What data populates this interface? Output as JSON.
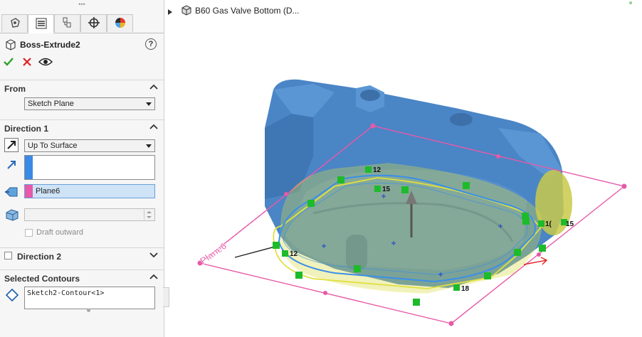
{
  "feature": {
    "title": "Boss-Extrude2",
    "help_icon_label": "?"
  },
  "panel_tabs": [
    {
      "name": "feature-manager-tab"
    },
    {
      "name": "property-manager-tab"
    },
    {
      "name": "configuration-manager-tab"
    },
    {
      "name": "dimxpert-manager-tab"
    },
    {
      "name": "display-manager-tab"
    }
  ],
  "sections": {
    "from": {
      "label": "From",
      "value": "Sketch Plane"
    },
    "direction1": {
      "label": "Direction 1",
      "end_condition": "Up To Surface",
      "surface_face": "Plane6",
      "draft_outward_label": "Draft outward"
    },
    "direction2": {
      "label": "Direction 2"
    },
    "selected_contours": {
      "label": "Selected Contours",
      "items": [
        "Sketch2-Contour<1>"
      ]
    }
  },
  "tree": {
    "root_label": "B60 Gas Valve Bottom  (D..."
  },
  "viewport": {
    "plane_label": "Plane6",
    "dimensions": [
      "12",
      "15",
      "12",
      "15",
      "18",
      "1(",
      "15"
    ]
  },
  "colors": {
    "part_blue": "#4a85c6",
    "plane_pink": "#e65aa8",
    "preview_yellow": "#d8d840",
    "relation_green": "#1dbb2a",
    "contour_blue": "#3a8fe8"
  }
}
